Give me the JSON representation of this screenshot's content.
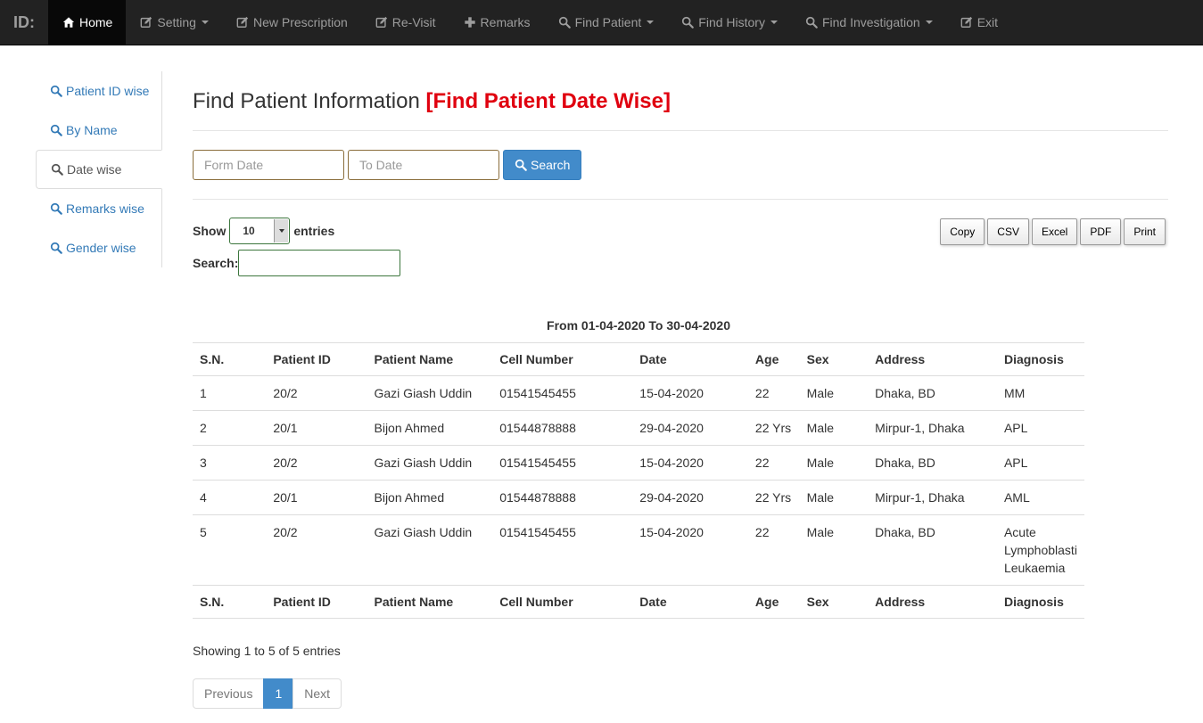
{
  "navbar": {
    "brand": "ID:",
    "items": [
      {
        "label": "Home",
        "icon": "home-icon",
        "dropdown": false
      },
      {
        "label": "Setting",
        "icon": "edit-icon",
        "dropdown": true
      },
      {
        "label": "New Prescription",
        "icon": "edit-icon",
        "dropdown": false
      },
      {
        "label": "Re-Visit",
        "icon": "edit-icon",
        "dropdown": false
      },
      {
        "label": "Remarks",
        "icon": "plus-icon",
        "dropdown": false
      },
      {
        "label": "Find Patient",
        "icon": "search-icon",
        "dropdown": true
      },
      {
        "label": "Find History",
        "icon": "search-icon",
        "dropdown": true
      },
      {
        "label": "Find Investigation",
        "icon": "search-icon",
        "dropdown": true
      },
      {
        "label": "Exit",
        "icon": "edit-icon",
        "dropdown": false
      }
    ]
  },
  "sidebar": {
    "items": [
      {
        "label": "Patient ID wise"
      },
      {
        "label": "By Name"
      },
      {
        "label": "Date wise"
      },
      {
        "label": "Remarks wise"
      },
      {
        "label": "Gender wise"
      }
    ],
    "active_index": 2
  },
  "main": {
    "title": "Find Patient Information",
    "subtitle": "[Find Patient Date Wise]",
    "from_placeholder": "Form Date",
    "to_placeholder": "To Date",
    "search_button": "Search"
  },
  "datatable": {
    "show_label": "Show",
    "entries_value": "10",
    "entries_label": "entries",
    "search_label": "Search:",
    "export_buttons": [
      "Copy",
      "CSV",
      "Excel",
      "PDF",
      "Print"
    ],
    "caption": "From 01-04-2020 To 30-04-2020",
    "columns": [
      "S.N.",
      "Patient ID",
      "Patient Name",
      "Cell Number",
      "Date",
      "Age",
      "Sex",
      "Address",
      "Diagnosis"
    ],
    "rows": [
      [
        "1",
        "20/2",
        "Gazi Giash Uddin",
        "01541545455",
        "15-04-2020",
        "22",
        "Male",
        "Dhaka, BD",
        "MM"
      ],
      [
        "2",
        "20/1",
        "Bijon Ahmed",
        "01544878888",
        "29-04-2020",
        "22 Yrs",
        "Male",
        "Mirpur-1, Dhaka",
        "APL"
      ],
      [
        "3",
        "20/2",
        "Gazi Giash Uddin",
        "01541545455",
        "15-04-2020",
        "22",
        "Male",
        "Dhaka, BD",
        "APL"
      ],
      [
        "4",
        "20/1",
        "Bijon Ahmed",
        "01544878888",
        "29-04-2020",
        "22 Yrs",
        "Male",
        "Mirpur-1, Dhaka",
        "AML"
      ],
      [
        "5",
        "20/2",
        "Gazi Giash Uddin",
        "01541545455",
        "15-04-2020",
        "22",
        "Male",
        "Dhaka, BD",
        "Acute Lymphoblasti Leukaemia"
      ]
    ],
    "info": "Showing 1 to 5 of 5 entries",
    "pager": {
      "previous": "Previous",
      "current": "1",
      "next": "Next"
    }
  },
  "colors": {
    "navbar": "#222222",
    "accent": "#428bca",
    "subtitle": "#e0000f",
    "link": "#337ab7"
  }
}
